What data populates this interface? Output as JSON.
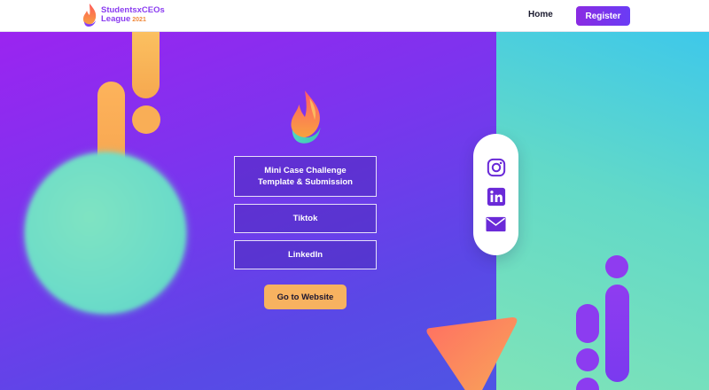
{
  "header": {
    "logo_name": "StudentsxCEOs",
    "logo_sub": "League",
    "logo_year": "2021",
    "nav_home": "Home",
    "register_label": "Register"
  },
  "main": {
    "links": [
      {
        "line1": "Mini Case Challenge",
        "line2": "Template & Submission"
      },
      {
        "line1": "Tiktok"
      },
      {
        "line1": "LinkedIn"
      }
    ],
    "website_button": "Go to Website"
  },
  "social": {
    "icons": [
      "instagram-icon",
      "linkedin-icon",
      "mail-icon"
    ]
  },
  "colors": {
    "brand_purple": "#8a2be2",
    "accent_orange": "#f7b260",
    "teal": "#6cdcc8"
  }
}
